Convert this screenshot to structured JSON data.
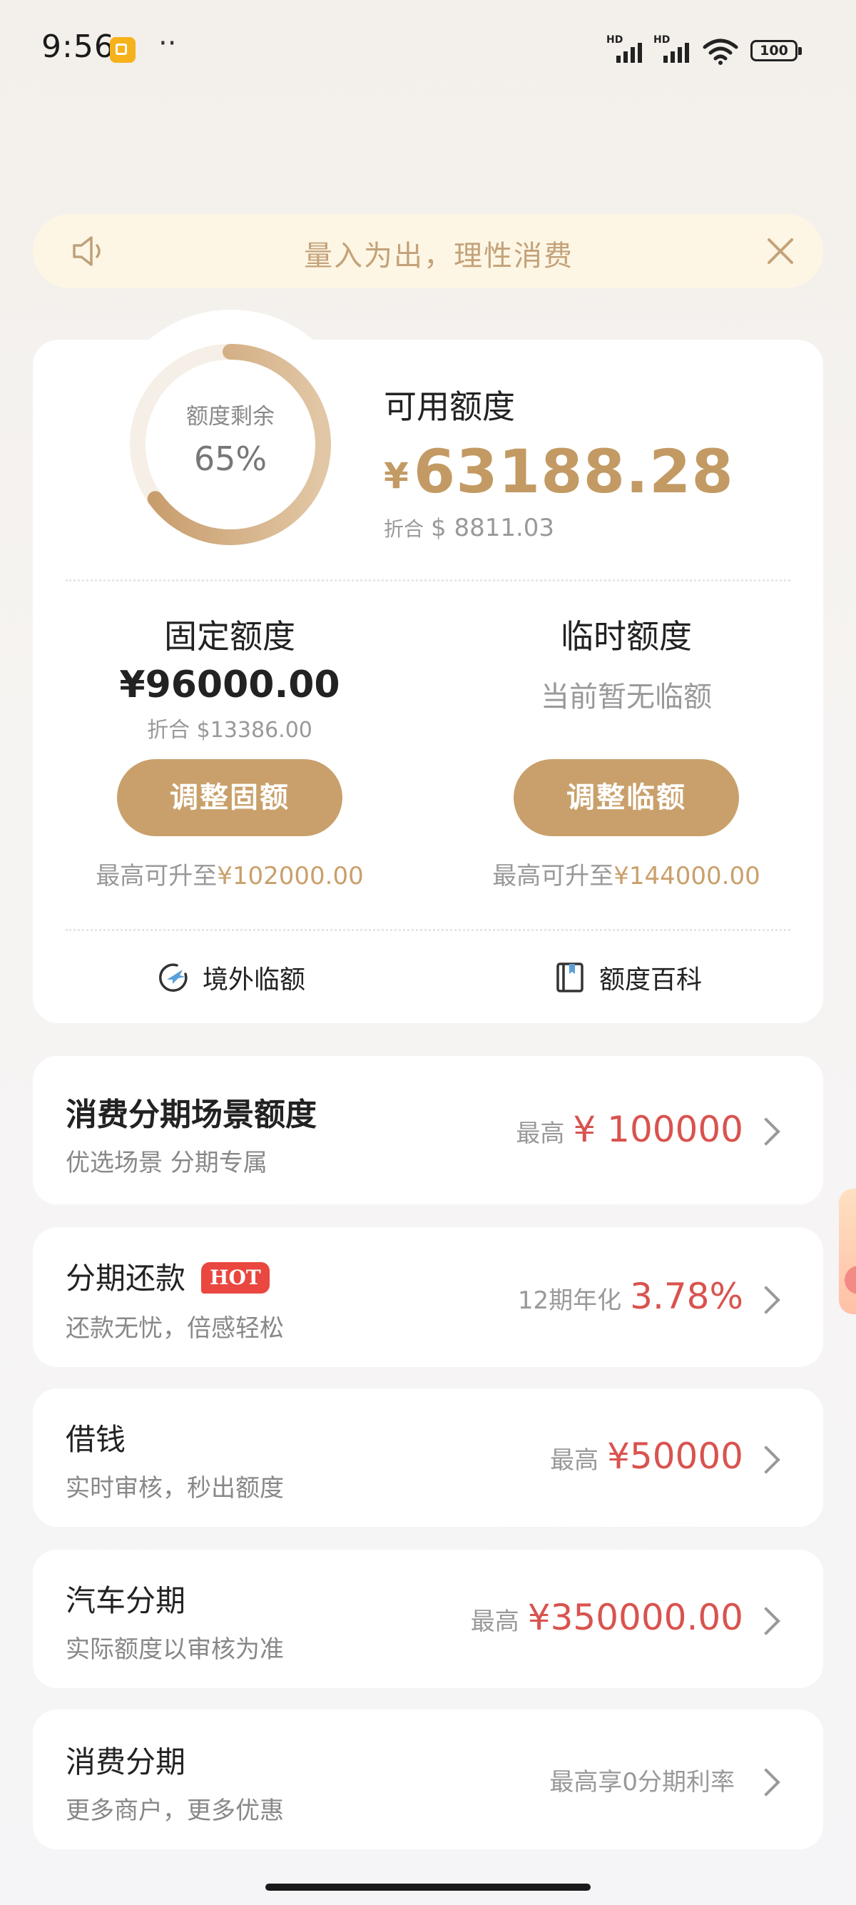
{
  "status_bar": {
    "time": "9:56",
    "dots": "··",
    "signal_1_label": "HD",
    "signal_2_label": "HD",
    "battery": "100"
  },
  "notice": {
    "text": "量入为出，理性消费",
    "icon": "speaker-icon",
    "close_icon": "close-icon"
  },
  "credit_card": {
    "ring_label": "额度剩余",
    "ring_value": "65%",
    "ring_fraction": 0.65,
    "available_title": "可用额度",
    "available_currency": "¥",
    "available_amount": "63188.28",
    "available_converted_prefix": "折合",
    "available_converted": "$ 8811.03",
    "fixed": {
      "title": "固定额度",
      "amount": "¥96000.00",
      "converted": "折合 $13386.00",
      "button": "调整固额",
      "max_prefix": "最高可升至",
      "max_value": "¥102000.00"
    },
    "temporary": {
      "title": "临时额度",
      "status": "当前暂无临额",
      "button": "调整临额",
      "max_prefix": "最高可升至",
      "max_value": "¥144000.00"
    },
    "tools": [
      {
        "label": "境外临额",
        "icon": "overseas-plane-icon"
      },
      {
        "label": "额度百科",
        "icon": "book-icon"
      }
    ]
  },
  "items": [
    {
      "title": "消费分期场景额度",
      "subtitle": "优选场景 分期专属",
      "prefix": "最高",
      "value": "¥ 100000"
    },
    {
      "title": "分期还款",
      "badge": "HOT",
      "subtitle": "还款无忧，倍感轻松",
      "prefix": "12期年化",
      "value": "3.78%"
    },
    {
      "title": "借钱",
      "subtitle": "实时审核，秒出额度",
      "prefix": "最高",
      "value": "¥50000"
    },
    {
      "title": "汽车分期",
      "subtitle": "实际额度以审核为准",
      "prefix": "最高",
      "value": "¥350000.00"
    },
    {
      "title": "消费分期",
      "subtitle": "更多商户，更多优惠",
      "prefix": "最高享0分期利率",
      "value": ""
    }
  ],
  "colors": {
    "gold": "#c9a06b",
    "red_value": "#d9534f",
    "notice_bg": "#fdf6e4"
  }
}
